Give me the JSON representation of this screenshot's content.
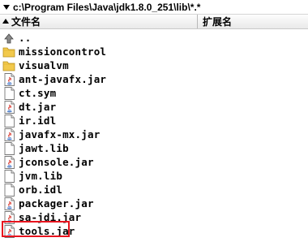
{
  "path": "c:\\Program Files\\Java\\jdk1.8.0_251\\lib\\*.*",
  "columns": {
    "name": "文件名",
    "ext": "扩展名"
  },
  "files": [
    {
      "name": "..",
      "icon": "up-arrow-icon"
    },
    {
      "name": "missioncontrol",
      "icon": "folder-icon"
    },
    {
      "name": "visualvm",
      "icon": "folder-icon"
    },
    {
      "name": "ant-javafx.jar",
      "icon": "jar-file-icon"
    },
    {
      "name": "ct.sym",
      "icon": "file-icon"
    },
    {
      "name": "dt.jar",
      "icon": "jar-file-icon"
    },
    {
      "name": "ir.idl",
      "icon": "file-icon"
    },
    {
      "name": "javafx-mx.jar",
      "icon": "jar-file-icon"
    },
    {
      "name": "jawt.lib",
      "icon": "file-icon"
    },
    {
      "name": "jconsole.jar",
      "icon": "jar-file-icon"
    },
    {
      "name": "jvm.lib",
      "icon": "file-icon"
    },
    {
      "name": "orb.idl",
      "icon": "file-icon"
    },
    {
      "name": "packager.jar",
      "icon": "jar-file-icon"
    },
    {
      "name": "sa-jdi.jar",
      "icon": "jar-file-icon"
    },
    {
      "name": "tools.jar",
      "icon": "jar-file-icon",
      "highlighted": true
    }
  ],
  "colors": {
    "highlight_border": "#e8141e",
    "folder": "#f2c94c"
  }
}
